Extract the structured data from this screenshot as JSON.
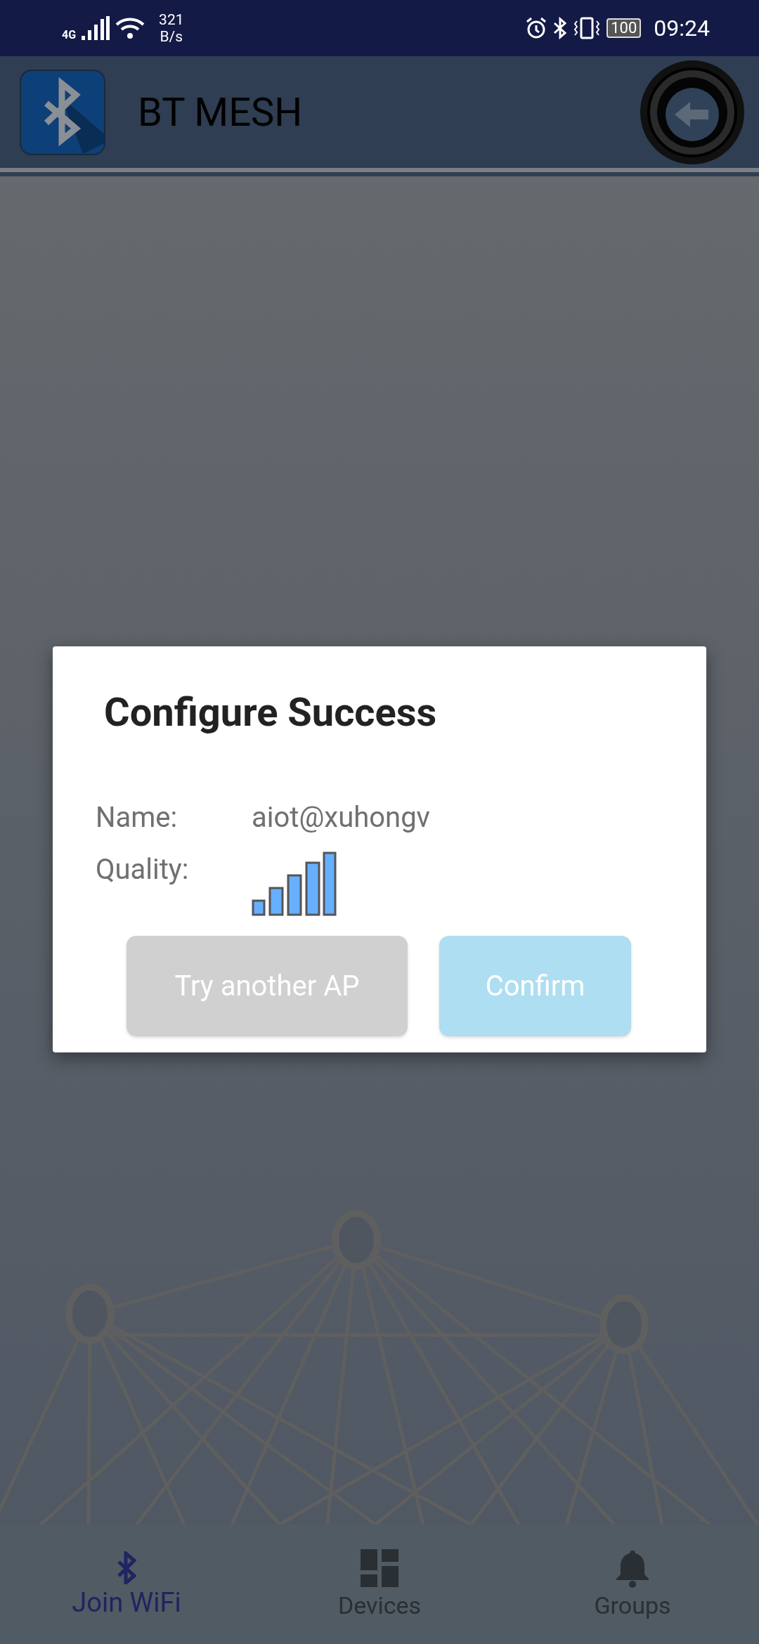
{
  "status_bar": {
    "network": "4G",
    "speed_value": "321",
    "speed_unit": "B/s",
    "battery": "100",
    "time": "09:24"
  },
  "header": {
    "title": "BT MESH"
  },
  "dialog": {
    "title": "Configure Success",
    "fields": [
      {
        "kind": "text",
        "label": "Name:",
        "value": "aiot@xuhongv"
      },
      {
        "kind": "signal",
        "label": "Quality:"
      }
    ],
    "buttons": [
      {
        "label": "Try another AP",
        "kind": "secondary"
      },
      {
        "label": "Confirm",
        "kind": "primary"
      }
    ]
  },
  "bottom_nav": [
    {
      "label": "Join WiFi",
      "kind": "bluetooth",
      "selected": true
    },
    {
      "label": "Devices",
      "kind": "dashboard",
      "selected": false
    },
    {
      "label": "Groups",
      "kind": "bell",
      "selected": false
    }
  ]
}
